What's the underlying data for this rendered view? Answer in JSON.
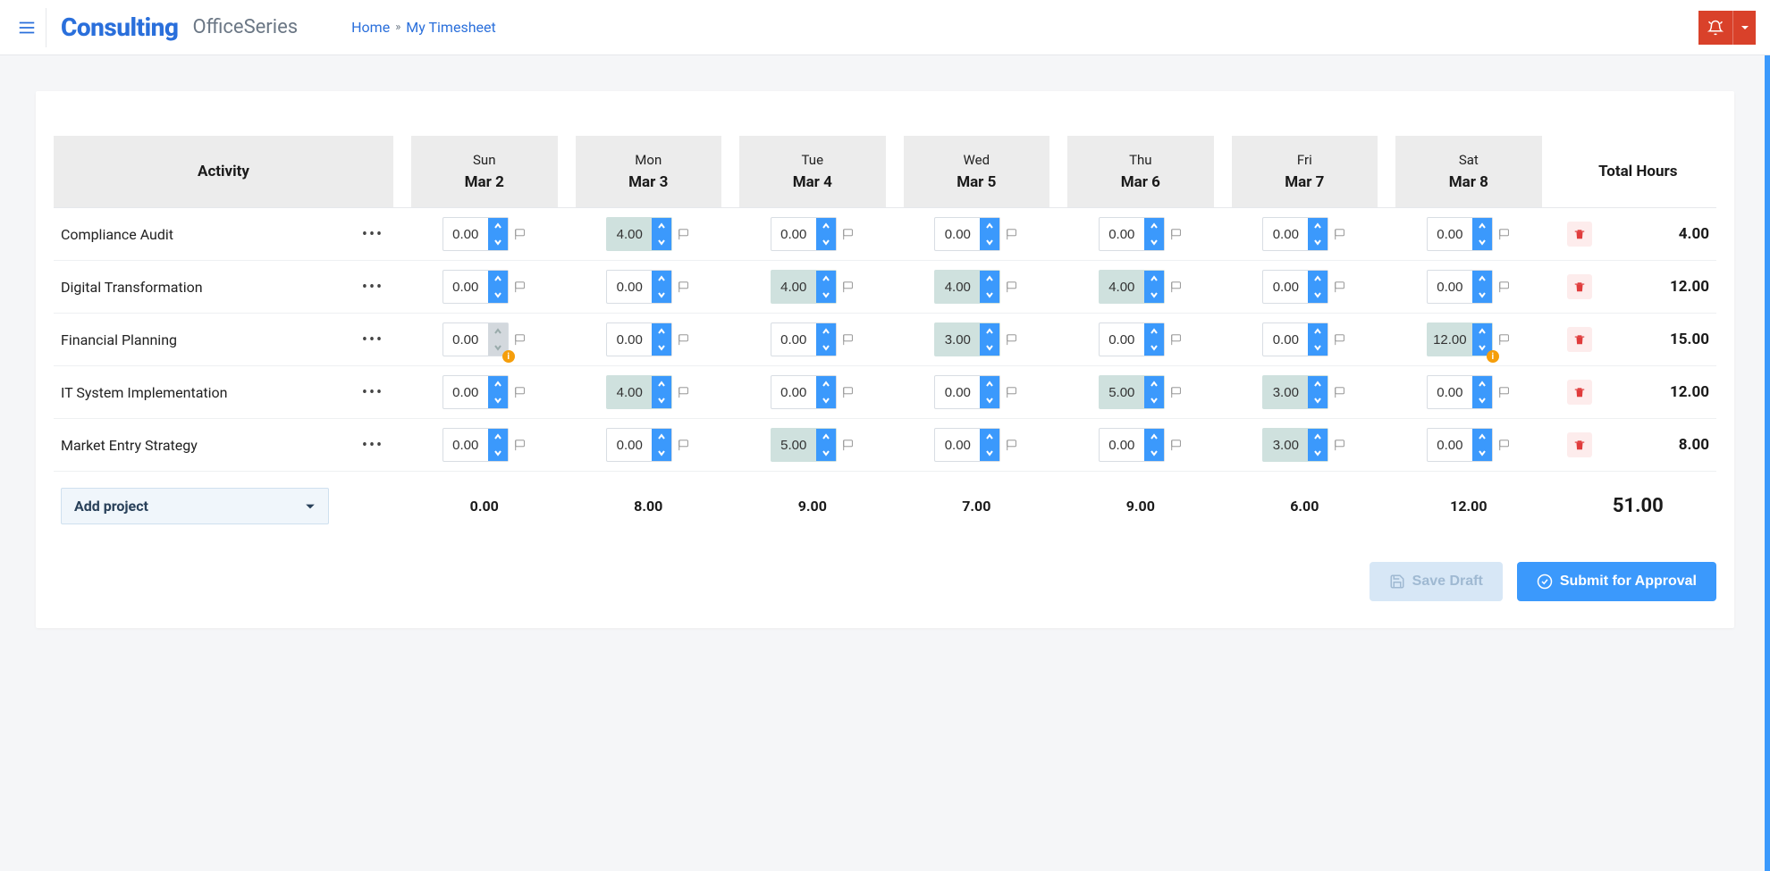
{
  "header": {
    "brand_main": "Consulting",
    "brand_sub": "OfficeSeries",
    "breadcrumb": {
      "home": "Home",
      "sep": "»",
      "current": "My Timesheet"
    }
  },
  "table": {
    "activity_header": "Activity",
    "total_header": "Total Hours",
    "days": [
      {
        "name": "Sun",
        "date": "Mar 2"
      },
      {
        "name": "Mon",
        "date": "Mar 3"
      },
      {
        "name": "Tue",
        "date": "Mar 4"
      },
      {
        "name": "Wed",
        "date": "Mar 5"
      },
      {
        "name": "Thu",
        "date": "Mar 6"
      },
      {
        "name": "Fri",
        "date": "Mar 7"
      },
      {
        "name": "Sat",
        "date": "Mar 8"
      }
    ],
    "rows": [
      {
        "name": "Compliance Audit",
        "cells": [
          {
            "v": "0.00",
            "filled": false
          },
          {
            "v": "4.00",
            "filled": true
          },
          {
            "v": "0.00",
            "filled": false
          },
          {
            "v": "0.00",
            "filled": false
          },
          {
            "v": "0.00",
            "filled": false
          },
          {
            "v": "0.00",
            "filled": false
          },
          {
            "v": "0.00",
            "filled": false
          }
        ],
        "total": "4.00"
      },
      {
        "name": "Digital Transformation",
        "cells": [
          {
            "v": "0.00",
            "filled": false
          },
          {
            "v": "0.00",
            "filled": false
          },
          {
            "v": "4.00",
            "filled": true
          },
          {
            "v": "4.00",
            "filled": true
          },
          {
            "v": "4.00",
            "filled": true
          },
          {
            "v": "0.00",
            "filled": false
          },
          {
            "v": "0.00",
            "filled": false
          }
        ],
        "total": "12.00"
      },
      {
        "name": "Financial Planning",
        "cells": [
          {
            "v": "0.00",
            "filled": false,
            "disabled": true,
            "alert": true
          },
          {
            "v": "0.00",
            "filled": false
          },
          {
            "v": "0.00",
            "filled": false
          },
          {
            "v": "3.00",
            "filled": true
          },
          {
            "v": "0.00",
            "filled": false
          },
          {
            "v": "0.00",
            "filled": false
          },
          {
            "v": "12.00",
            "filled": true,
            "alert": true
          }
        ],
        "total": "15.00"
      },
      {
        "name": "IT System Implementation",
        "cells": [
          {
            "v": "0.00",
            "filled": false
          },
          {
            "v": "4.00",
            "filled": true
          },
          {
            "v": "0.00",
            "filled": false
          },
          {
            "v": "0.00",
            "filled": false
          },
          {
            "v": "5.00",
            "filled": true
          },
          {
            "v": "3.00",
            "filled": true
          },
          {
            "v": "0.00",
            "filled": false
          }
        ],
        "total": "12.00"
      },
      {
        "name": "Market Entry Strategy",
        "cells": [
          {
            "v": "0.00",
            "filled": false
          },
          {
            "v": "0.00",
            "filled": false
          },
          {
            "v": "5.00",
            "filled": true
          },
          {
            "v": "0.00",
            "filled": false
          },
          {
            "v": "0.00",
            "filled": false
          },
          {
            "v": "3.00",
            "filled": true
          },
          {
            "v": "0.00",
            "filled": false
          }
        ],
        "total": "8.00"
      }
    ],
    "day_totals": [
      "0.00",
      "8.00",
      "9.00",
      "7.00",
      "9.00",
      "6.00",
      "12.00"
    ],
    "grand_total": "51.00",
    "add_project": "Add project"
  },
  "actions": {
    "save_draft": "Save Draft",
    "submit": "Submit for Approval"
  }
}
